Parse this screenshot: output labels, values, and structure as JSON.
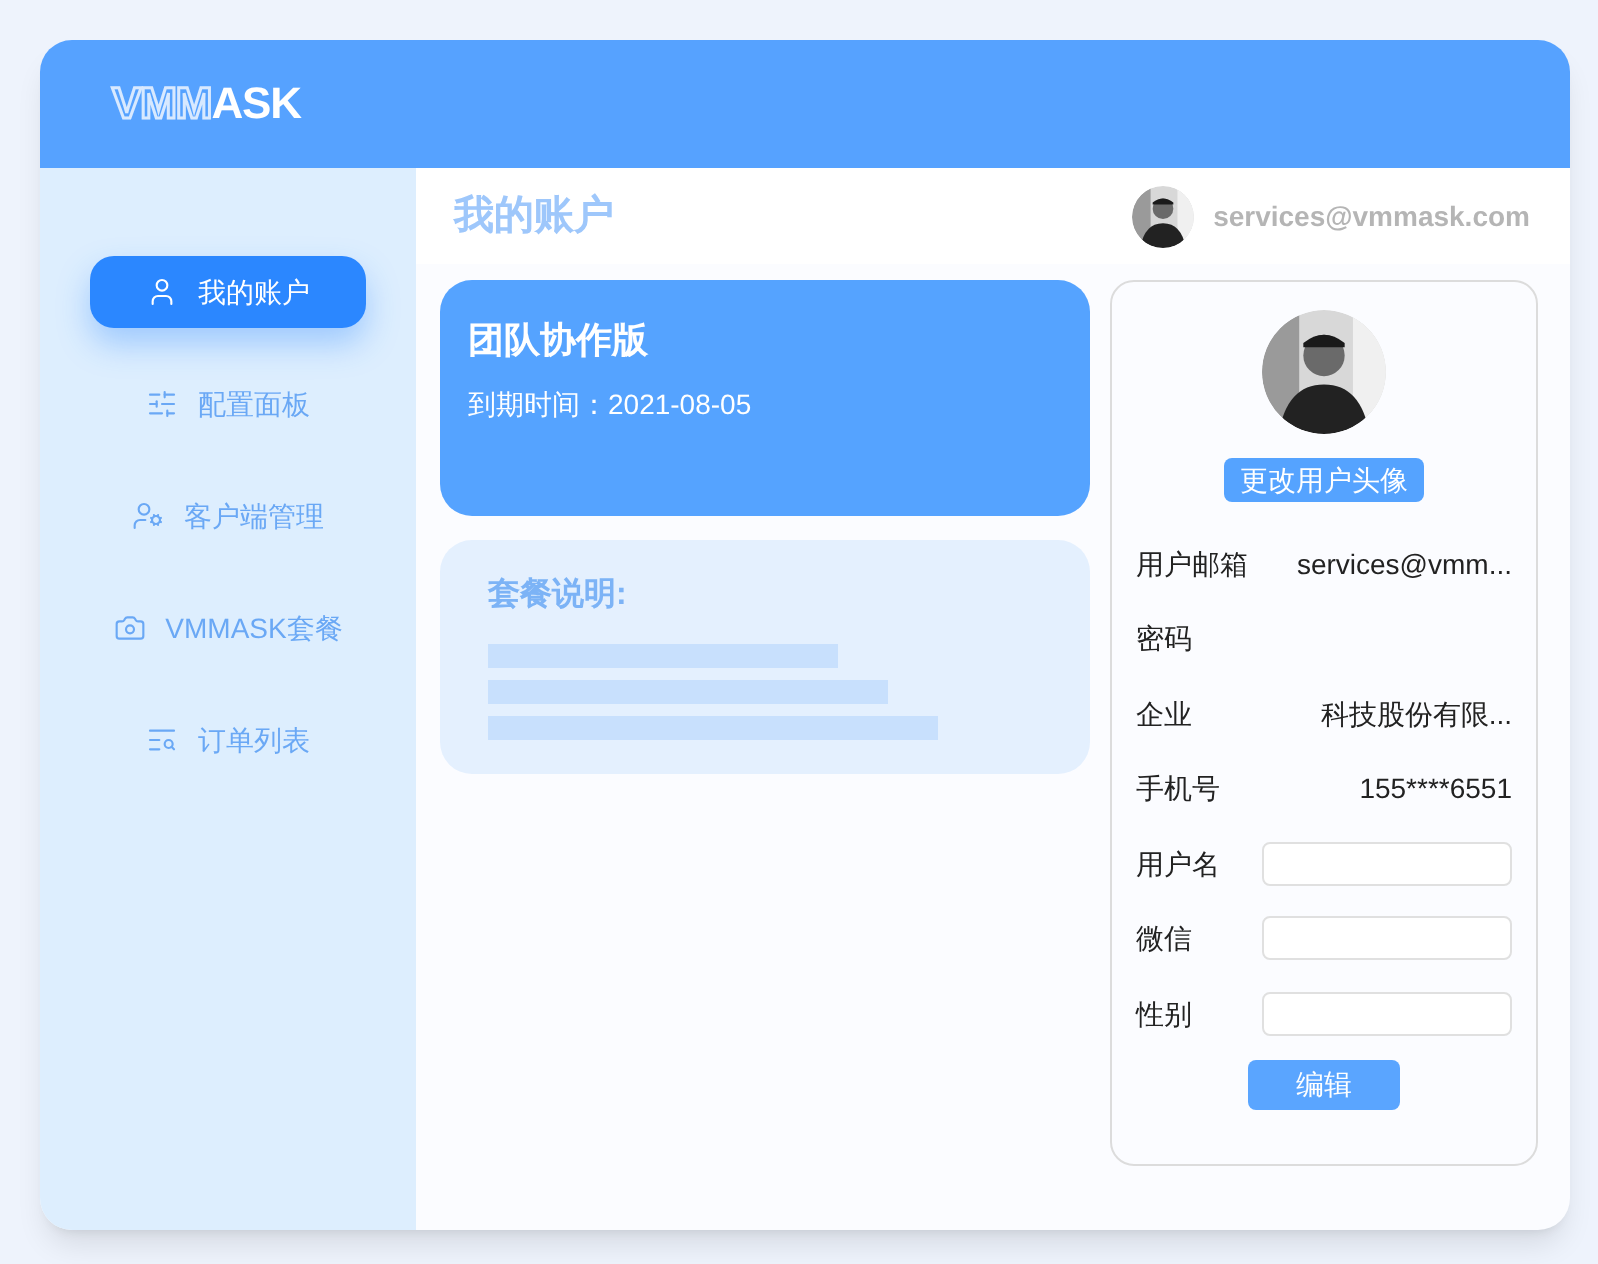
{
  "logo": {
    "outline": "VMM",
    "solid": "ASK"
  },
  "sidebar": {
    "items": [
      {
        "label": "我的账户",
        "selected": true
      },
      {
        "label": "配置面板",
        "selected": false
      },
      {
        "label": "客户端管理",
        "selected": false
      },
      {
        "label": "VMMASK套餐",
        "selected": false
      },
      {
        "label": "订单列表",
        "selected": false
      }
    ]
  },
  "page_title": "我的账户",
  "user": {
    "email": "services@vmmask.com"
  },
  "plan_card": {
    "name": "团队协作版",
    "expiry": "到期时间：2021-08-05"
  },
  "plan_info": {
    "title": "套餐说明:"
  },
  "profile": {
    "change_avatar": "更改用户头像",
    "rows": [
      {
        "kind": "text",
        "label": "用户邮箱",
        "value": "services@vmm..."
      },
      {
        "kind": "text",
        "label": "密码"
      },
      {
        "kind": "text",
        "label": "企业",
        "value": "科技股份有限..."
      },
      {
        "kind": "text",
        "label": "手机号",
        "value": "155****6551"
      },
      {
        "kind": "input",
        "label": "用户名"
      },
      {
        "kind": "input",
        "label": "微信"
      },
      {
        "kind": "input",
        "label": "性别"
      }
    ],
    "edit_button": "编辑"
  }
}
